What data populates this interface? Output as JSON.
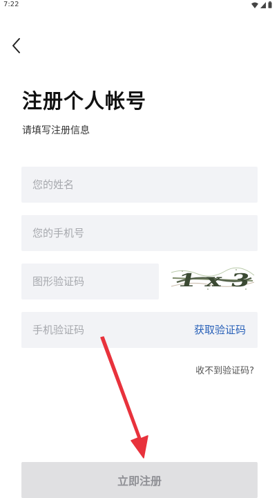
{
  "status_bar": {
    "time": "7:22",
    "icons": [
      "wifi-icon",
      "signal-icon",
      "battery-icon"
    ]
  },
  "header": {
    "back_icon": "chevron-left-icon",
    "title": "注册个人帐号",
    "subtitle": "请填写注册信息"
  },
  "form": {
    "name_placeholder": "您的姓名",
    "phone_placeholder": "您的手机号",
    "captcha_placeholder": "图形验证码",
    "captcha_image_text": "1 x 3",
    "sms_placeholder": "手机验证码",
    "get_code_label": "获取验证码",
    "no_code_label": "收不到验证码?"
  },
  "actions": {
    "submit_label": "立即注册"
  },
  "colors": {
    "field_bg": "#f2f3f6",
    "placeholder": "#a6a8ad",
    "link_blue": "#2860b8",
    "button_bg": "#e0e0e2",
    "button_text": "#8f9095",
    "annotation_red": "#e8323c"
  }
}
